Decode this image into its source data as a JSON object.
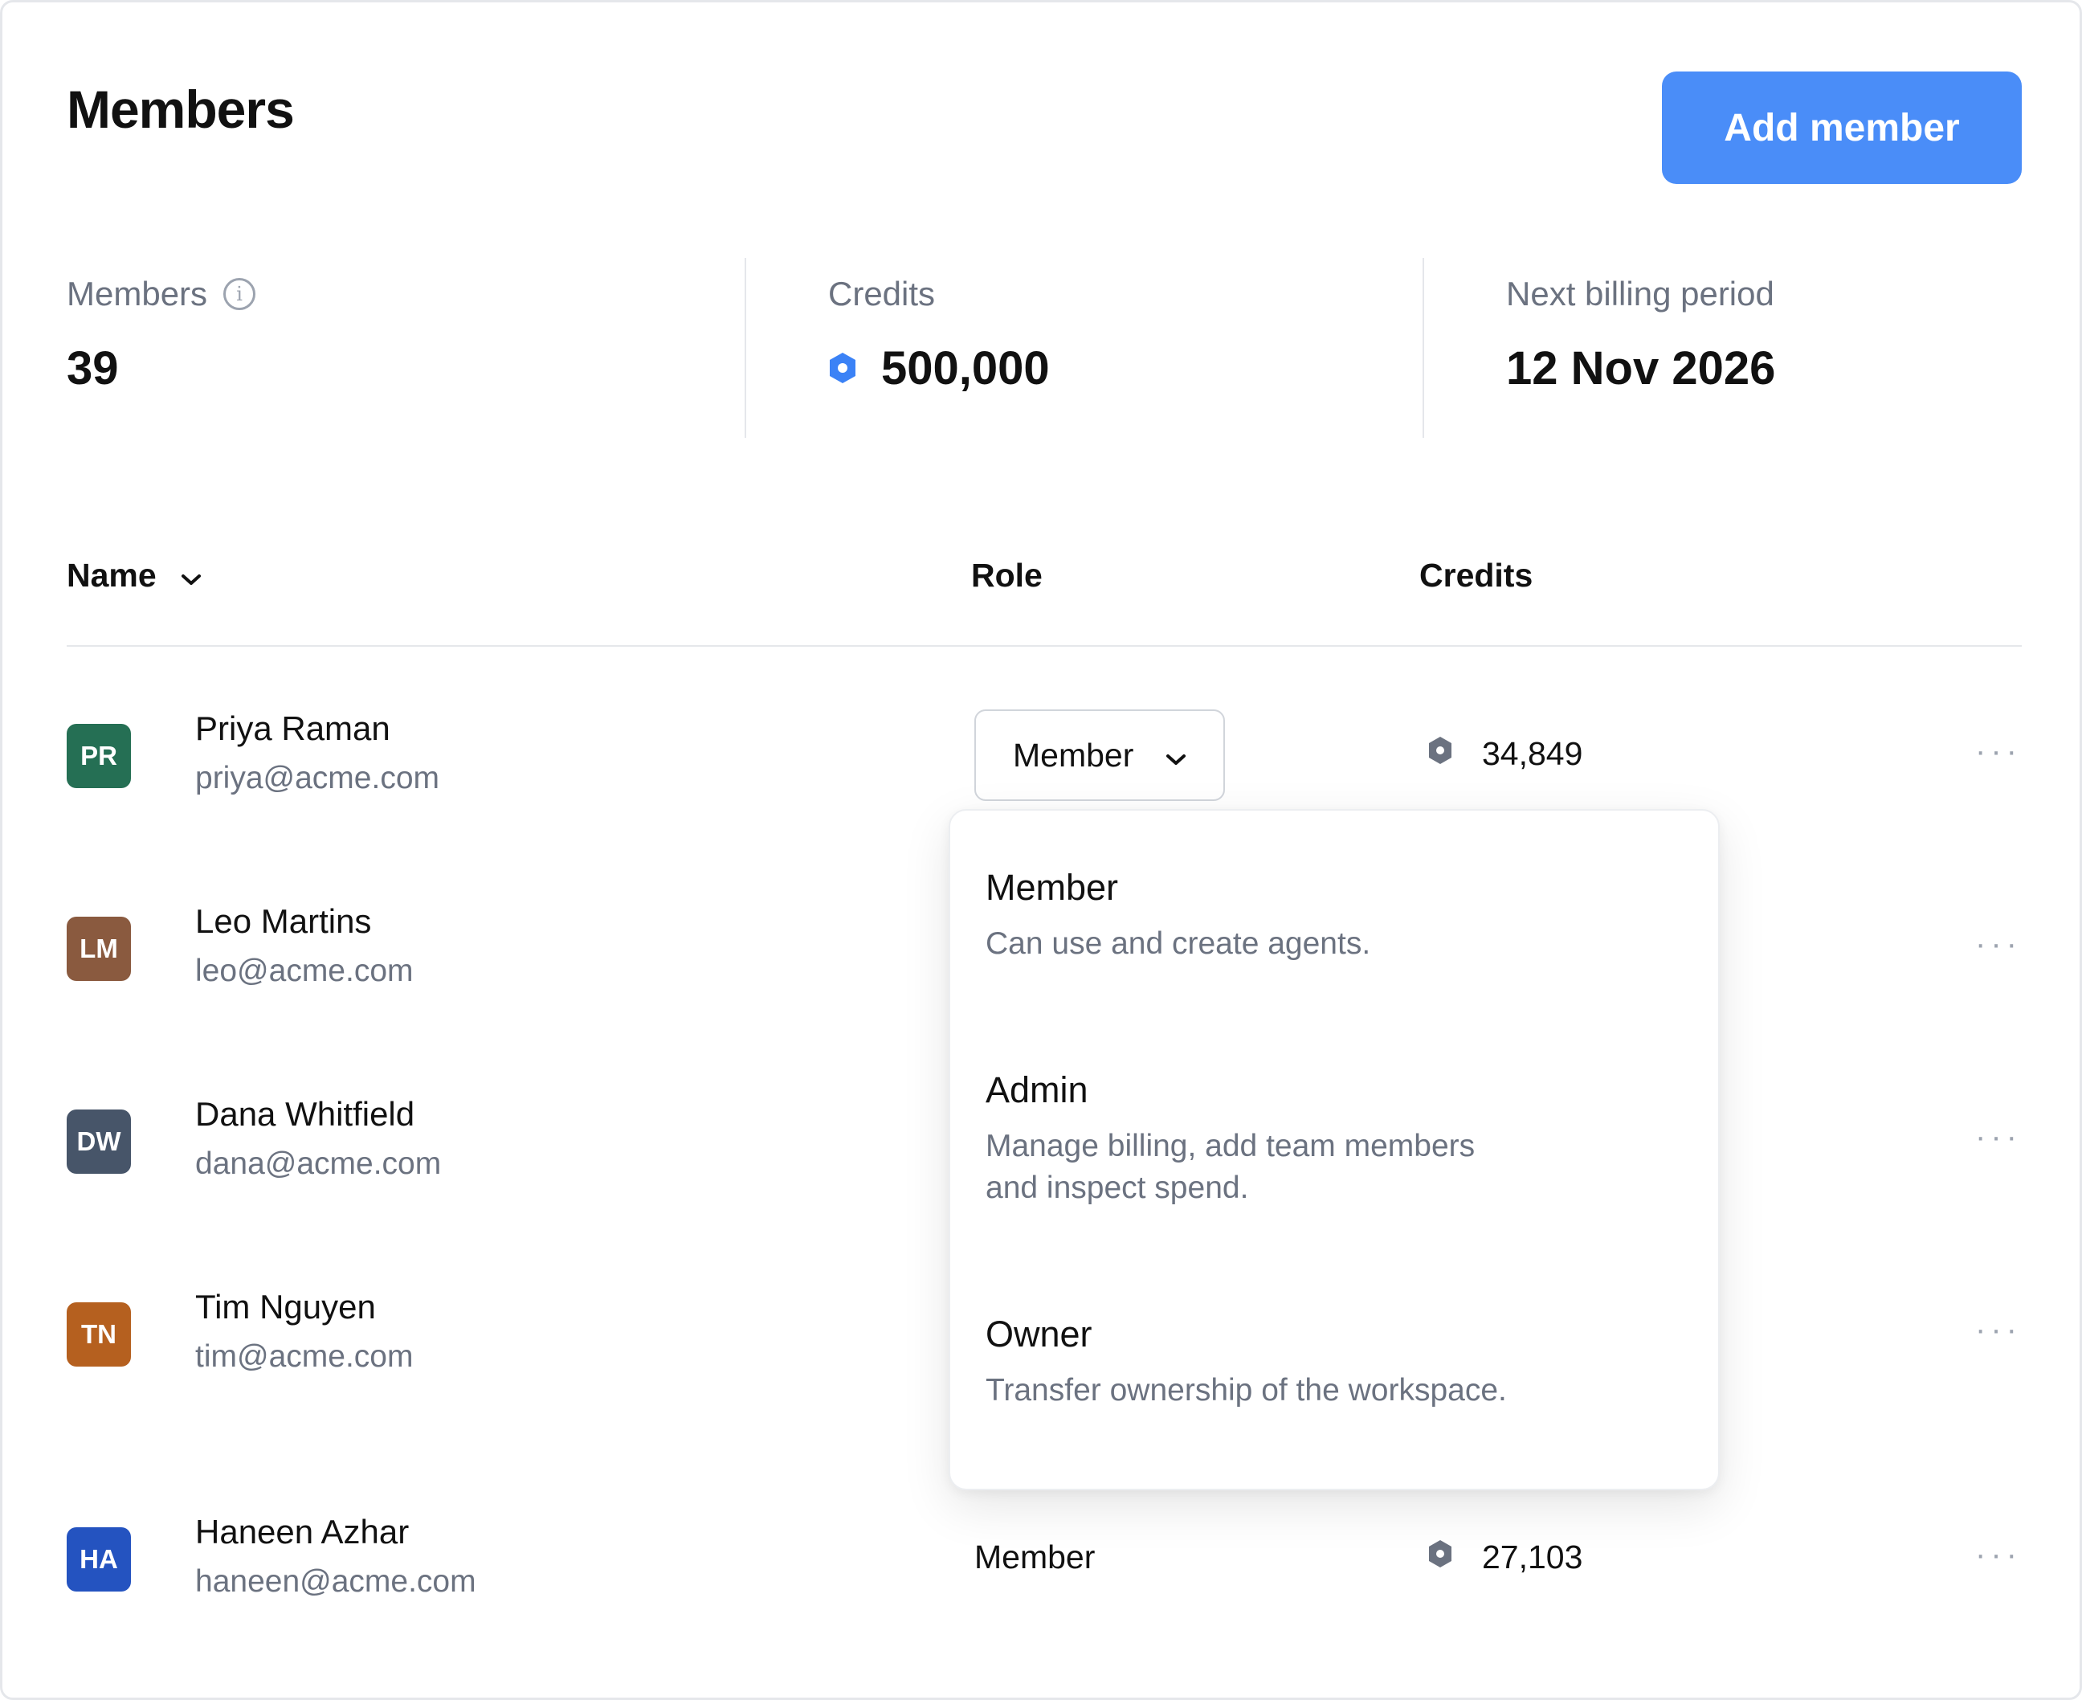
{
  "header": {
    "title": "Members",
    "add_button_label": "Add member"
  },
  "stats": {
    "members": {
      "label": "Members",
      "value": "39"
    },
    "credits": {
      "label": "Credits",
      "value": "500,000"
    },
    "billing": {
      "label": "Next billing period",
      "value": "12 Nov 2026"
    }
  },
  "table": {
    "columns": {
      "name": "Name",
      "role": "Role",
      "credits": "Credits"
    },
    "rows": [
      {
        "initials": "PR",
        "avatar_color": "#256f54",
        "name": "Priya Raman",
        "email": "priya@acme.com",
        "role": "Member",
        "credits": "34,849"
      },
      {
        "initials": "LM",
        "avatar_color": "#8a5a3f",
        "name": "Leo Martins",
        "email": "leo@acme.com"
      },
      {
        "initials": "DW",
        "avatar_color": "#475569",
        "name": "Dana Whitfield",
        "email": "dana@acme.com"
      },
      {
        "initials": "TN",
        "avatar_color": "#b5601f",
        "name": "Tim Nguyen",
        "email": "tim@acme.com"
      },
      {
        "initials": "HA",
        "avatar_color": "#2453c0",
        "name": "Haneen Azhar",
        "email": "haneen@acme.com",
        "role": "Member",
        "credits": "27,103"
      }
    ]
  },
  "role_menu": {
    "items": [
      {
        "title": "Member",
        "description": "Can use and create agents."
      },
      {
        "title": "Admin",
        "description_line1": "Manage billing, add team members",
        "description_line2": "and inspect spend."
      },
      {
        "title": "Owner",
        "description": "Transfer ownership of the workspace."
      }
    ]
  },
  "icons": {
    "info": "info-icon",
    "credit": "hexagon-credit-icon",
    "sort": "chevron-down-icon",
    "more": "more-horizontal-icon"
  },
  "colors": {
    "accent": "#4a8df8",
    "credit_total_icon": "#3b82f6",
    "credit_row_icon": "#6b7280"
  },
  "more_label": "···"
}
